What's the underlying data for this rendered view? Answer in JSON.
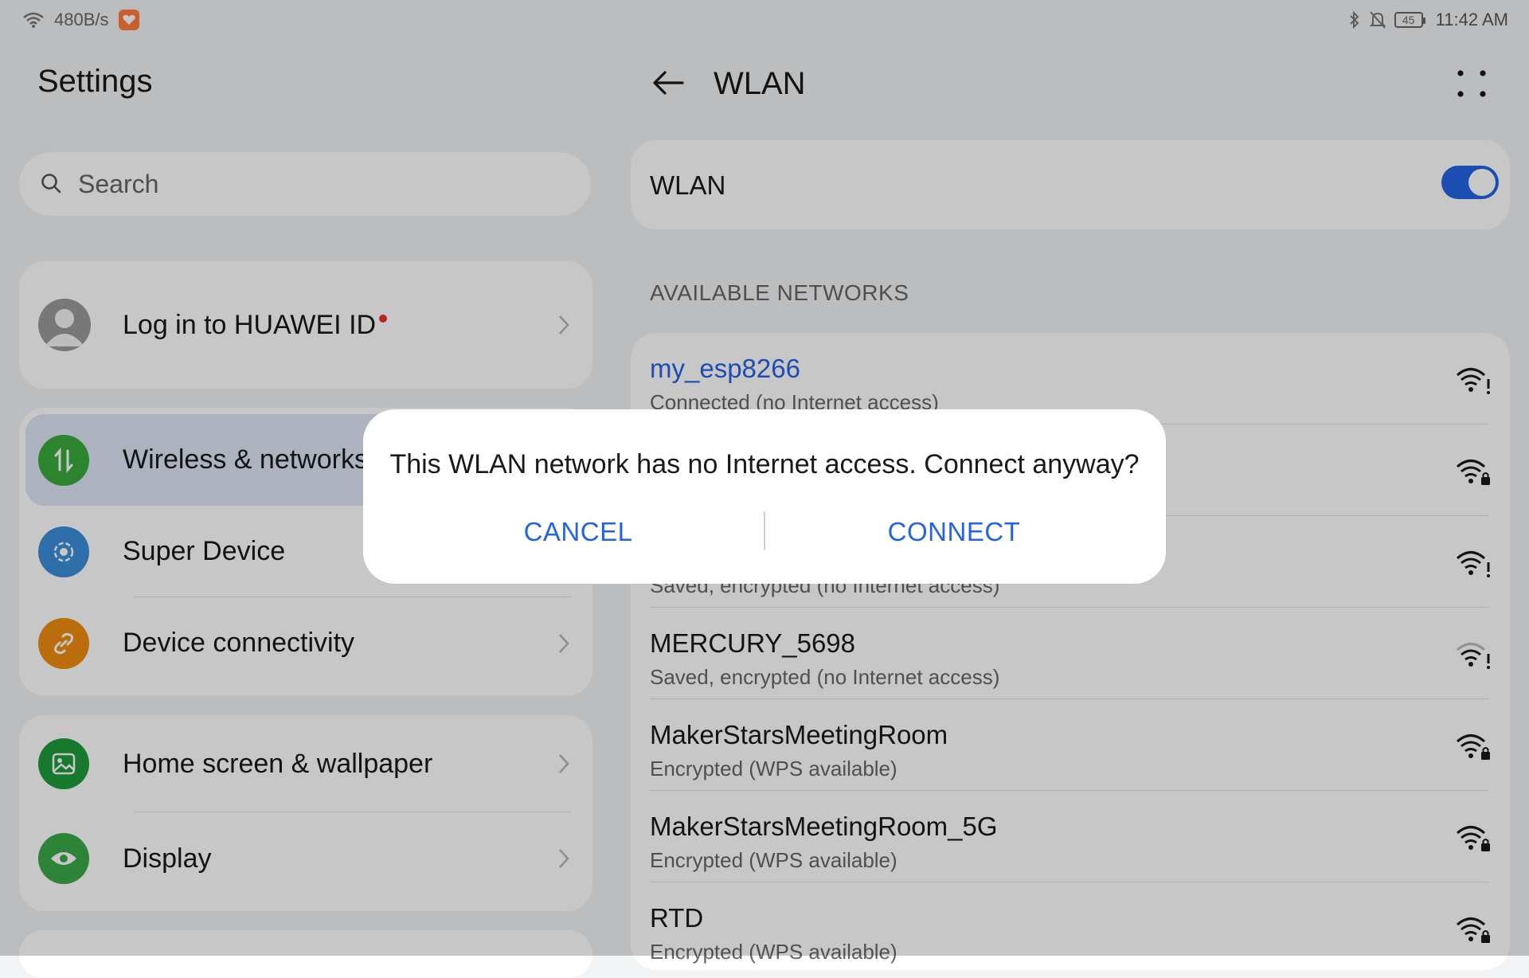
{
  "status_bar": {
    "speed": "480B/s",
    "time": "11:42 AM",
    "battery": "45"
  },
  "left": {
    "title": "Settings",
    "search": {
      "placeholder": "Search"
    },
    "account": {
      "label": "Log in to HUAWEI ID"
    },
    "group1": [
      {
        "label": "Wireless & networks",
        "icon": "arrows-icon",
        "color": "#3aa93d"
      },
      {
        "label": "Super Device",
        "icon": "super-device-icon",
        "color": "#3b8fd9"
      },
      {
        "label": "Device connectivity",
        "icon": "link-icon",
        "color": "#ef8c0e"
      }
    ],
    "group2": [
      {
        "label": "Home screen & wallpaper",
        "icon": "image-icon",
        "color": "#1d9c3a"
      },
      {
        "label": "Display",
        "icon": "eye-icon",
        "color": "#3aaa49"
      }
    ]
  },
  "right": {
    "title": "WLAN",
    "wlan_toggle": {
      "label": "WLAN",
      "on": true
    },
    "section_title": "AVAILABLE NETWORKS",
    "networks": [
      {
        "name": "my_esp8266",
        "status": "Connected (no Internet access)",
        "connected": true
      },
      {
        "name": "",
        "status": ""
      },
      {
        "name": "",
        "status": "Saved, encrypted (no Internet access)"
      },
      {
        "name": "MERCURY_5698",
        "status": "Saved, encrypted (no Internet access)"
      },
      {
        "name": "MakerStarsMeetingRoom",
        "status": "Encrypted (WPS available)"
      },
      {
        "name": "MakerStarsMeetingRoom_5G",
        "status": "Encrypted (WPS available)"
      },
      {
        "name": "RTD",
        "status": "Encrypted (WPS available)"
      }
    ]
  },
  "dialog": {
    "message": "This WLAN network has no Internet access. Connect anyway?",
    "cancel": "CANCEL",
    "connect": "CONNECT"
  },
  "colors": {
    "accent": "#2563e6",
    "background": "#f1f3f5"
  }
}
